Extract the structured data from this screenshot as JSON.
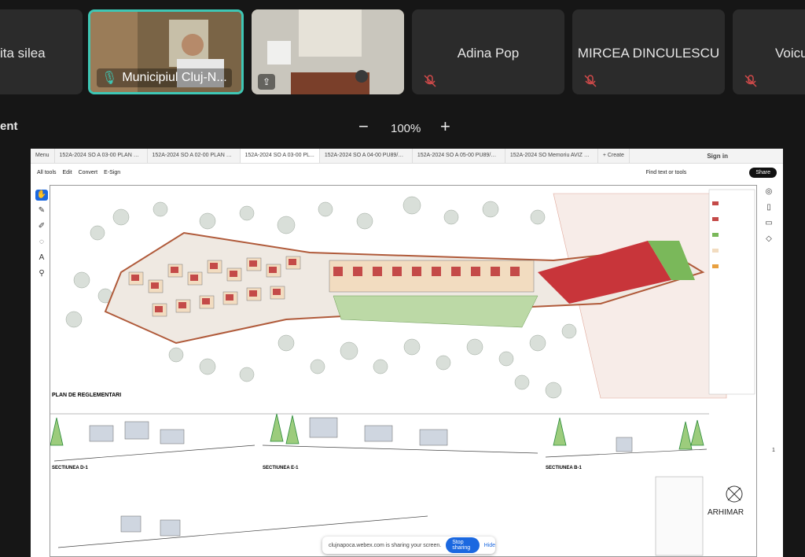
{
  "participants": [
    {
      "name": "ita silea",
      "muted": false
    },
    {
      "name": "Municipiul Cluj-N...",
      "video": true,
      "active": true
    },
    {
      "name": "",
      "video": true,
      "share_icon": true
    },
    {
      "name": "Adina Pop",
      "muted": true
    },
    {
      "name": "MIRCEA DINCULESCU",
      "muted": true
    },
    {
      "name": "Voicu",
      "muted": true
    }
  ],
  "controls": {
    "label": "ent",
    "zoom": "100%",
    "minus": "−",
    "plus": "+"
  },
  "pdf": {
    "tabs": [
      "Menu",
      "152A-2024 SO A 03-00 PLAN DE I...",
      "152A-2024 SO A 02-00 PLAN DE...",
      "152A-2024 SO A 03-00 PL...",
      "152A-2024 SO A 04-00 PU89/PE...",
      "152A-2024 SO A 05-00 PU89/PE...",
      "152A-2024 SO Memoriu AVIZ DE...",
      "+ Create"
    ],
    "signin": "Sign in",
    "menu": [
      "All tools",
      "Edit",
      "Convert",
      "E-Sign"
    ],
    "find": "Find text or tools",
    "share": "Share",
    "title_left": "PLAN DE REGLEMENTARI",
    "sections": [
      "SECTIUNEA D-1",
      "SECTIUNEA E-1",
      "SECTIUNEA B-1"
    ],
    "logo": "ARHIMAR",
    "page": "1"
  },
  "share_banner": {
    "text": "clujnapoca.webex.com is sharing your screen.",
    "stop": "Stop sharing",
    "hide": "Hide"
  }
}
